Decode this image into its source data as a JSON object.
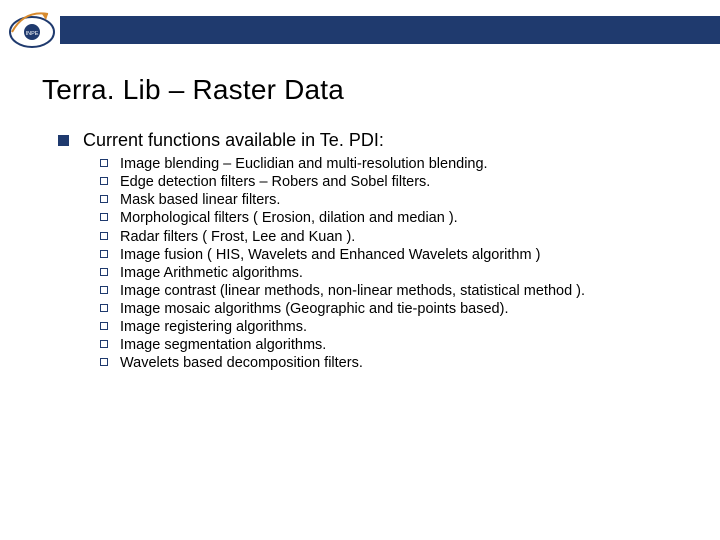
{
  "logo": {
    "label": "INPE"
  },
  "title": "Terra. Lib – Raster Data",
  "l1": {
    "text": "Current functions available in Te. PDI:"
  },
  "items": [
    "Image blending – Euclidian and multi-resolution blending.",
    "Edge detection filters – Robers and Sobel filters.",
    "Mask based linear filters.",
    "Morphological filters ( Erosion, dilation and median ).",
    "Radar filters ( Frost, Lee and Kuan ).",
    "Image fusion ( HIS, Wavelets and Enhanced Wavelets algorithm )",
    "Image Arithmetic algorithms.",
    "Image contrast (linear methods, non-linear methods, statistical method ).",
    "Image mosaic algorithms (Geographic and tie-points based).",
    "Image registering algorithms.",
    "Image segmentation algorithms.",
    "Wavelets based decomposition filters."
  ]
}
